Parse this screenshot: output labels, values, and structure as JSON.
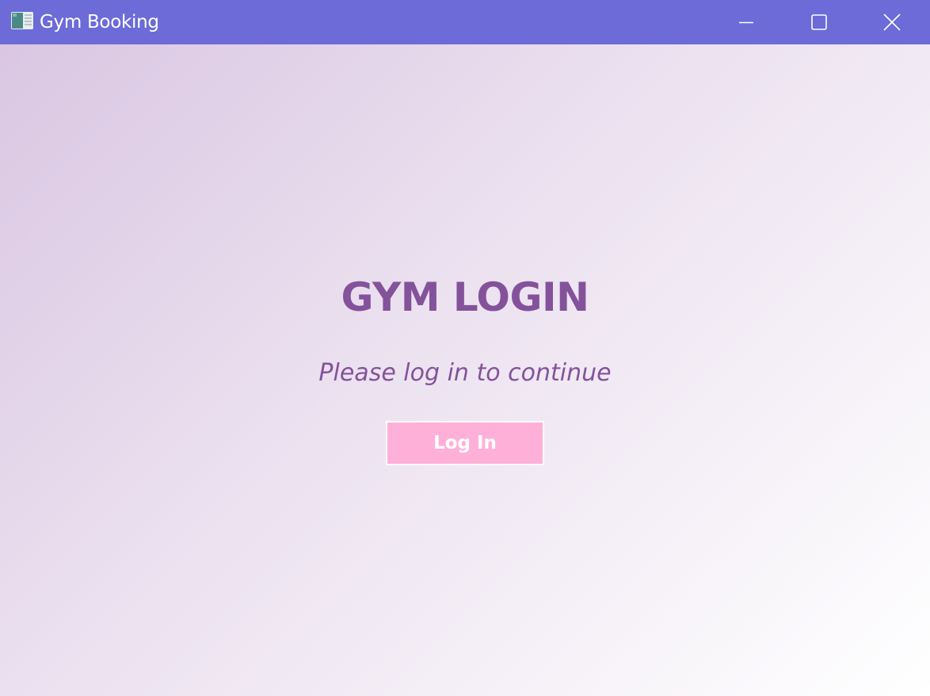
{
  "window": {
    "title": "Gym Booking",
    "controls": {
      "minimize_icon": "minimize-icon",
      "maximize_icon": "maximize-icon",
      "close_icon": "close-icon"
    }
  },
  "login": {
    "heading": "GYM LOGIN",
    "subtitle": "Please log in to continue",
    "button_label": "Log In"
  },
  "colors": {
    "titlebar": "#6c6bd8",
    "heading_text": "#84529a",
    "button_background": "#ffb0d8",
    "gradient_start": "#dac6e2",
    "gradient_end": "#ffffff"
  }
}
